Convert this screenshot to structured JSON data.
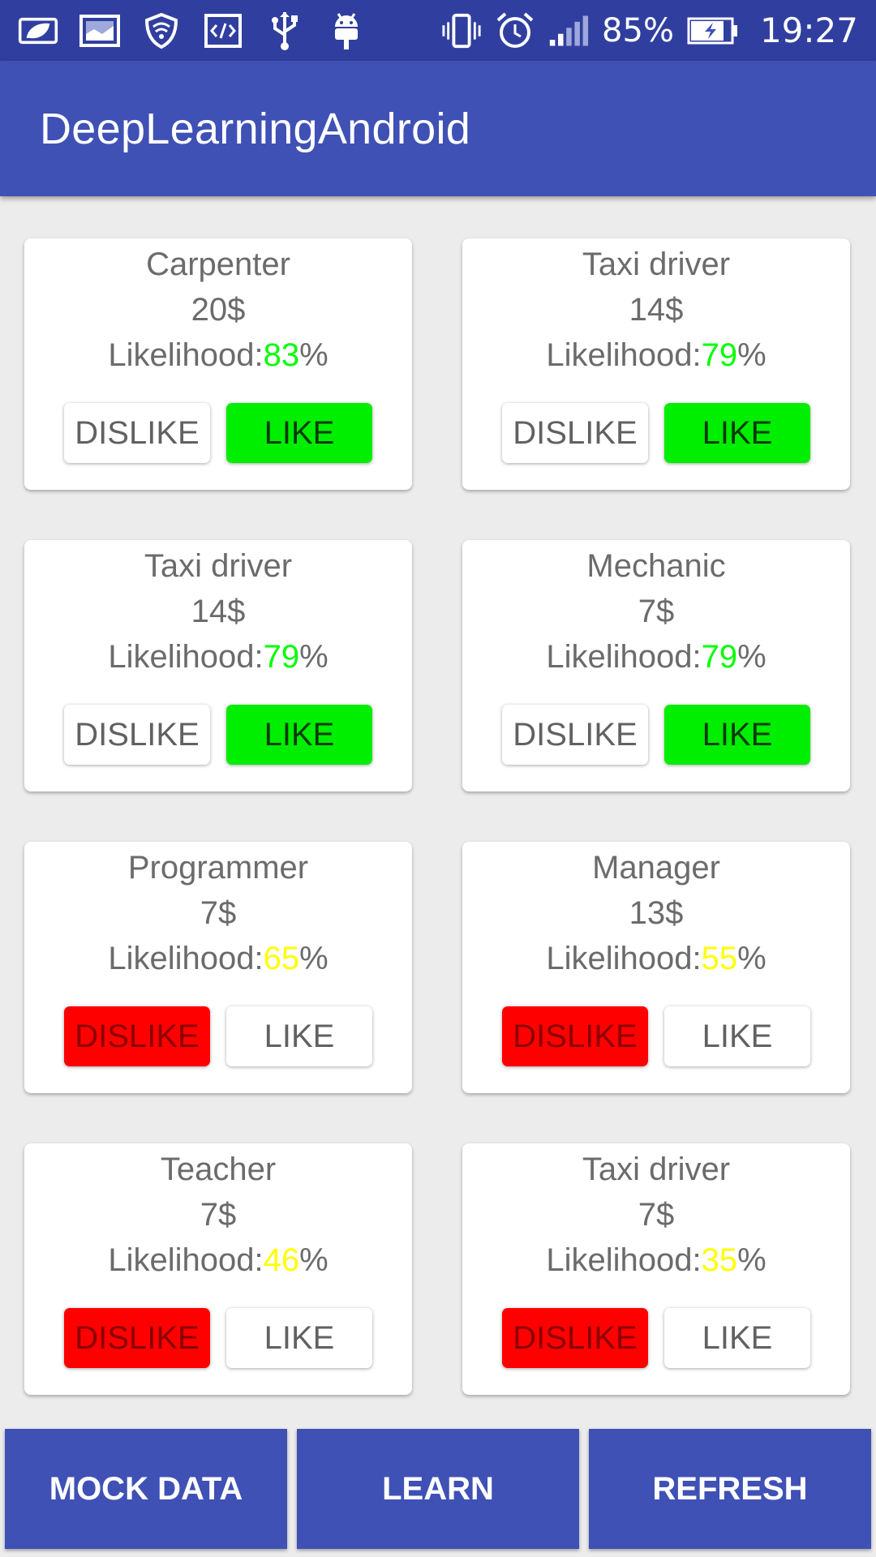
{
  "status_bar": {
    "battery_percent": "85%",
    "time": "19:27",
    "icons": [
      "leaf-icon",
      "gallery-icon",
      "shield-wifi-icon",
      "code-icon",
      "usb-icon",
      "android-icon",
      "vibrate-icon",
      "alarm-icon",
      "signal-icon",
      "battery-charging-icon"
    ]
  },
  "app_bar": {
    "title": "DeepLearningAndroid"
  },
  "colors": {
    "primary": "#3f51b5",
    "primary_dark": "#303f9f",
    "like_active": "#00ee00",
    "dislike_active": "#ff0000",
    "likelihood_high": "#00ff00",
    "likelihood_mid": "#ffff00"
  },
  "cards": [
    {
      "job": "Carpenter",
      "pay": "20$",
      "likelihood_label": "Likelihood:",
      "likelihood": "83",
      "unit": "%",
      "dislike": "DISLIKE",
      "like": "LIKE",
      "selected": "like"
    },
    {
      "job": "Taxi driver",
      "pay": "14$",
      "likelihood_label": "Likelihood:",
      "likelihood": "79",
      "unit": "%",
      "dislike": "DISLIKE",
      "like": "LIKE",
      "selected": "like"
    },
    {
      "job": "Taxi driver",
      "pay": "14$",
      "likelihood_label": "Likelihood:",
      "likelihood": "79",
      "unit": "%",
      "dislike": "DISLIKE",
      "like": "LIKE",
      "selected": "like"
    },
    {
      "job": "Mechanic",
      "pay": "7$",
      "likelihood_label": "Likelihood:",
      "likelihood": "79",
      "unit": "%",
      "dislike": "DISLIKE",
      "like": "LIKE",
      "selected": "like"
    },
    {
      "job": "Programmer",
      "pay": "7$",
      "likelihood_label": "Likelihood:",
      "likelihood": "65",
      "unit": "%",
      "dislike": "DISLIKE",
      "like": "LIKE",
      "selected": "dislike"
    },
    {
      "job": "Manager",
      "pay": "13$",
      "likelihood_label": "Likelihood:",
      "likelihood": "55",
      "unit": "%",
      "dislike": "DISLIKE",
      "like": "LIKE",
      "selected": "dislike"
    },
    {
      "job": "Teacher",
      "pay": "7$",
      "likelihood_label": "Likelihood:",
      "likelihood": "46",
      "unit": "%",
      "dislike": "DISLIKE",
      "like": "LIKE",
      "selected": "dislike"
    },
    {
      "job": "Taxi driver",
      "pay": "7$",
      "likelihood_label": "Likelihood:",
      "likelihood": "35",
      "unit": "%",
      "dislike": "DISLIKE",
      "like": "LIKE",
      "selected": "dislike"
    }
  ],
  "bottom_buttons": {
    "mock_data": "MOCK DATA",
    "learn": "LEARN",
    "refresh": "REFRESH"
  }
}
